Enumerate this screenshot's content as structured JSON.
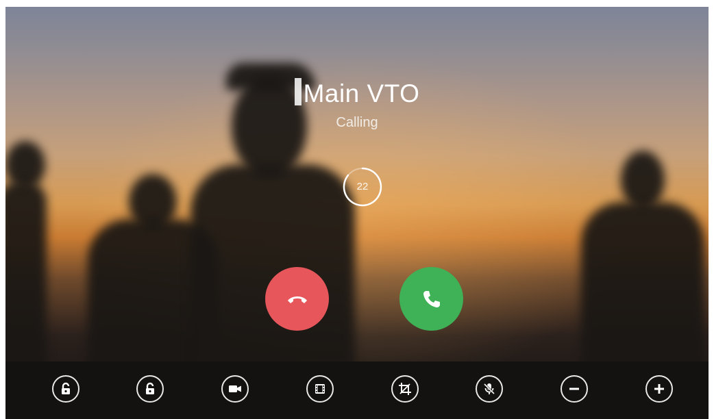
{
  "call": {
    "caller_name": "Main VTO",
    "status": "Calling",
    "countdown": "22"
  },
  "buttons": {
    "hangup": {
      "icon": "hangup-icon",
      "color": "#e6565b"
    },
    "answer": {
      "icon": "phone-icon",
      "color": "#3fb157"
    }
  },
  "toolbar": {
    "items": [
      {
        "icon": "unlock-icon"
      },
      {
        "icon": "unlock-icon"
      },
      {
        "icon": "video-camera-icon"
      },
      {
        "icon": "film-icon"
      },
      {
        "icon": "snapshot-crop-icon"
      },
      {
        "icon": "mute-microphone-icon"
      },
      {
        "icon": "volume-down-icon"
      },
      {
        "icon": "volume-up-icon"
      }
    ]
  }
}
